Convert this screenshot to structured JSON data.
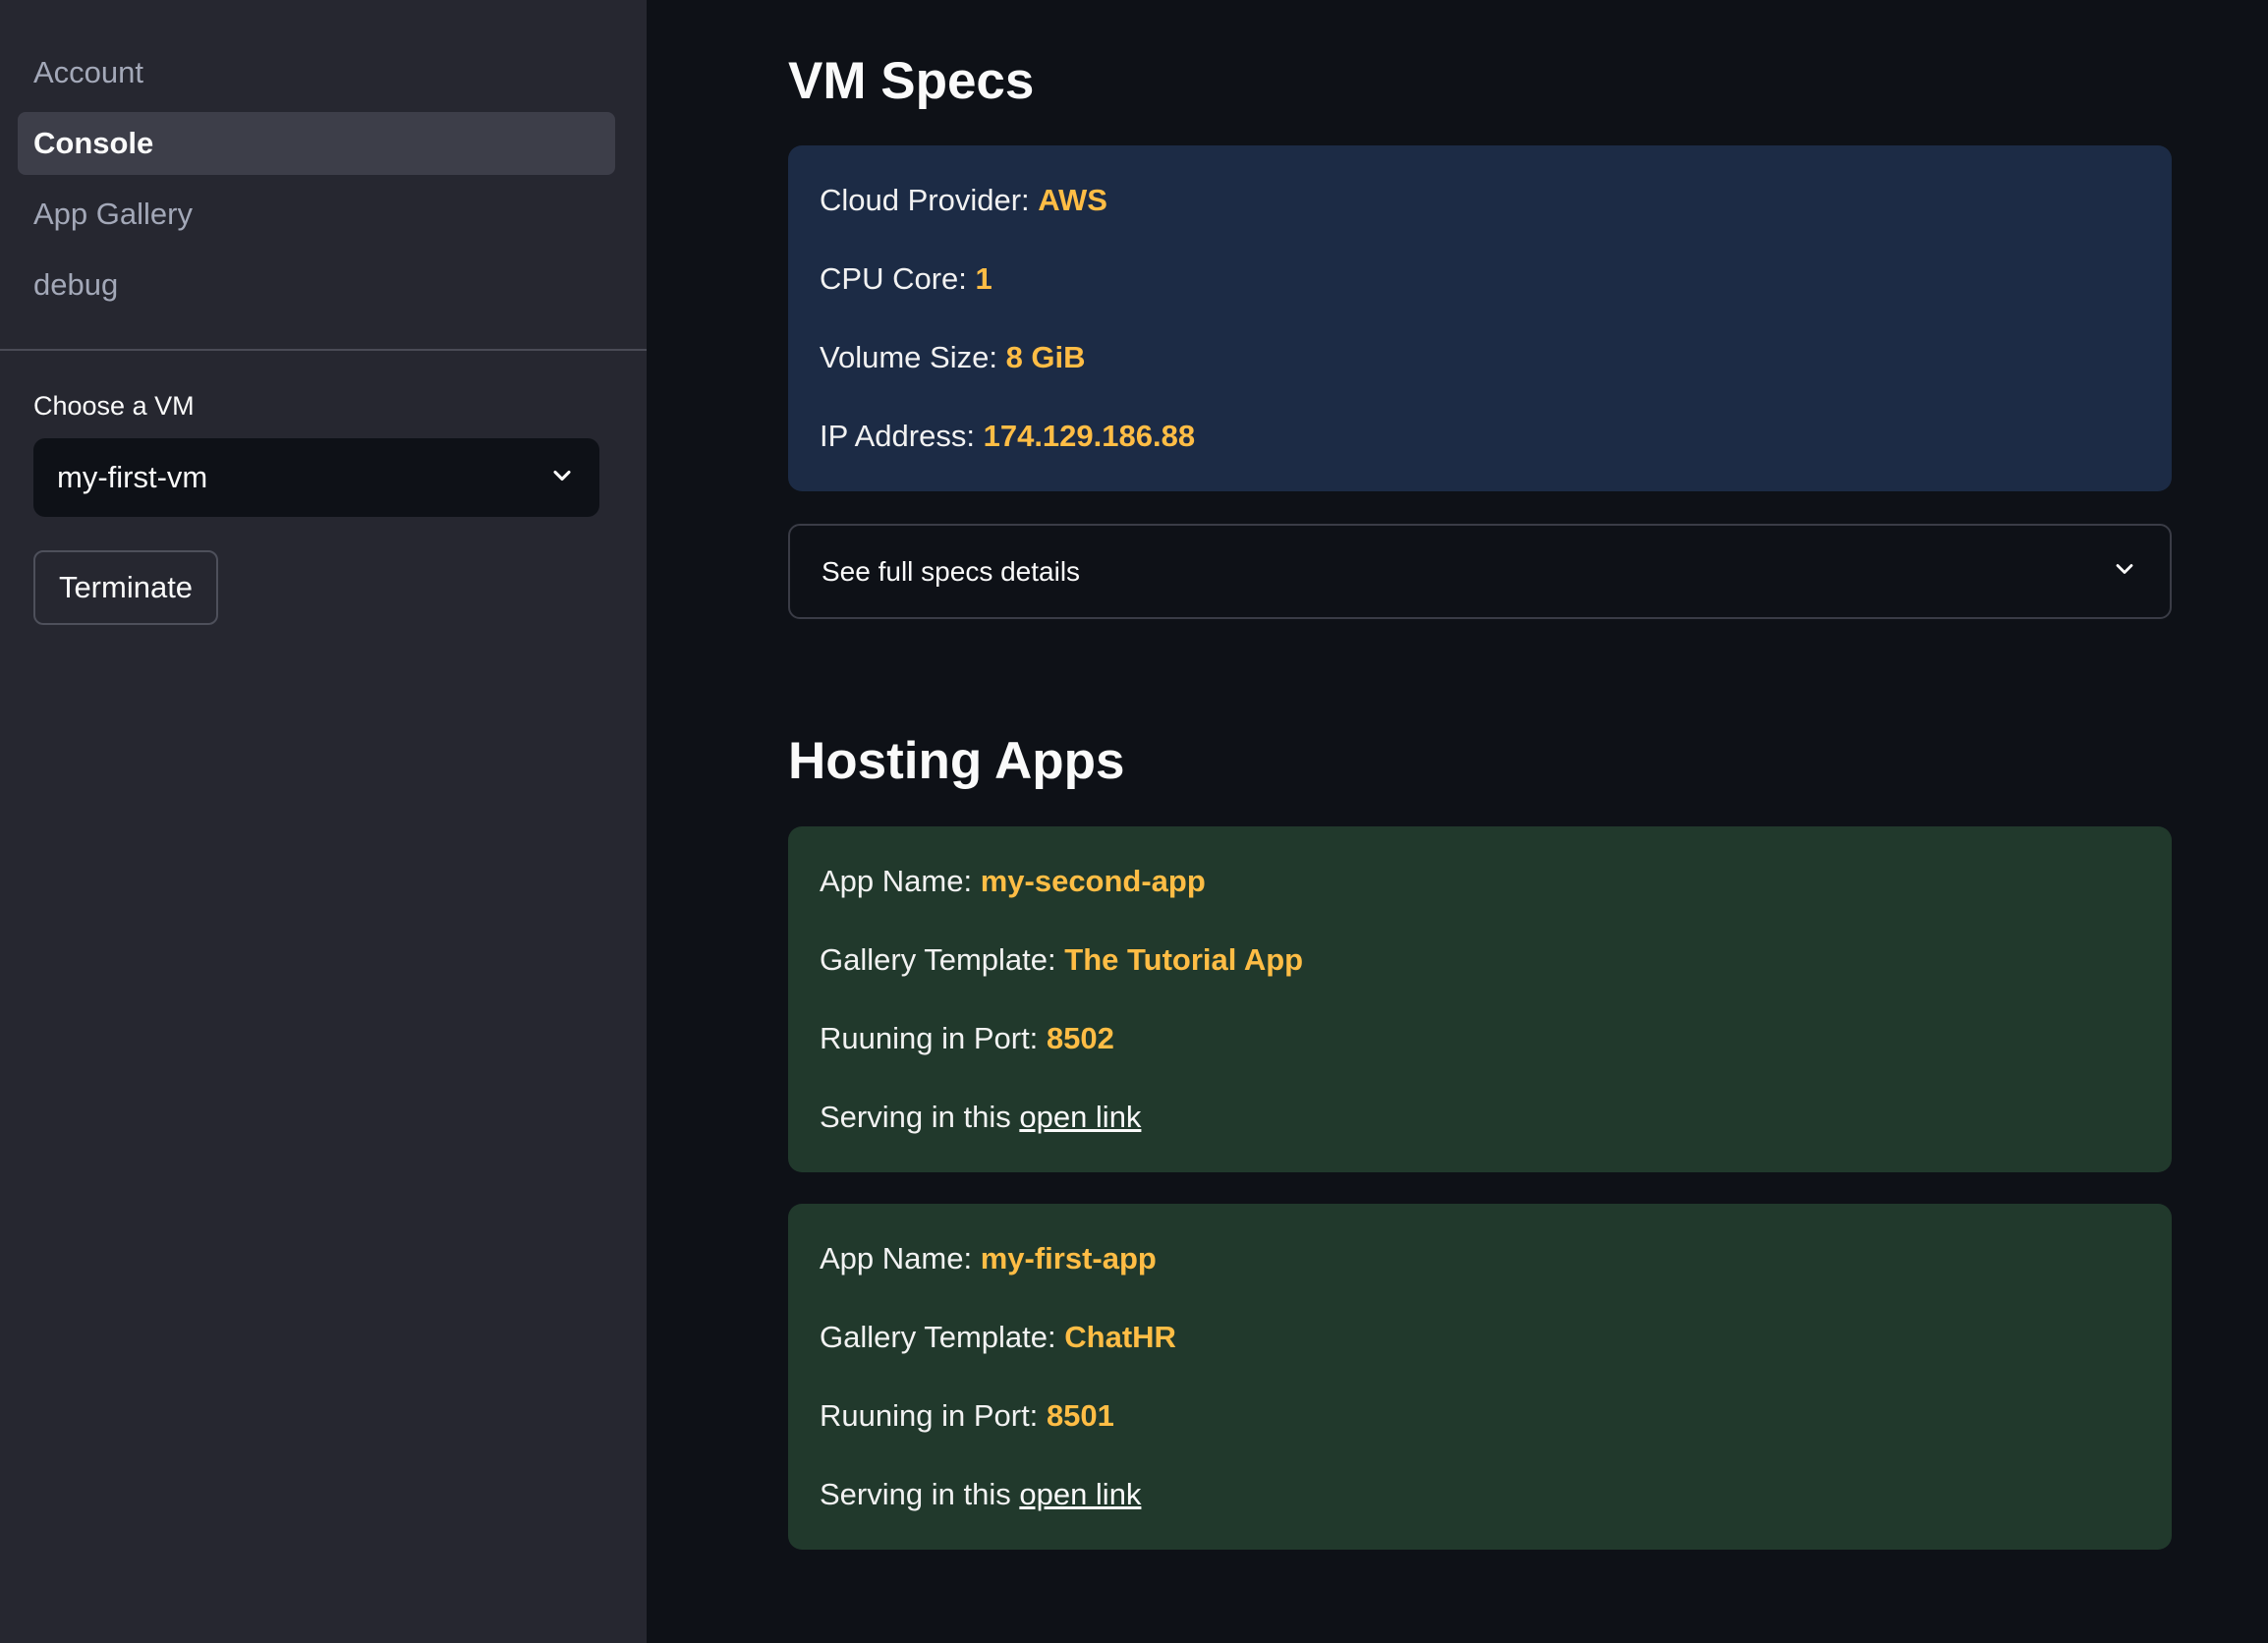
{
  "sidebar": {
    "nav": [
      {
        "label": "Account",
        "active": false
      },
      {
        "label": "Console",
        "active": true
      },
      {
        "label": "App Gallery",
        "active": false
      },
      {
        "label": "debug",
        "active": false
      }
    ],
    "vm_select": {
      "label": "Choose a VM",
      "value": "my-first-vm"
    },
    "terminate_label": "Terminate"
  },
  "vm_specs": {
    "title": "VM Specs",
    "fields": [
      {
        "label": "Cloud Provider:",
        "value": "AWS"
      },
      {
        "label": "CPU Core:",
        "value": "1"
      },
      {
        "label": "Volume Size:",
        "value": "8 GiB"
      },
      {
        "label": "IP Address:",
        "value": "174.129.186.88"
      }
    ],
    "expander_label": "See full specs details"
  },
  "hosting_apps": {
    "title": "Hosting Apps",
    "apps": [
      {
        "name_label": "App Name:",
        "name": "my-second-app",
        "template_label": "Gallery Template:",
        "template": "The Tutorial App",
        "port_label": "Ruuning in Port:",
        "port": "8502",
        "serving_label": "Serving in this",
        "link_text": "open link"
      },
      {
        "name_label": "App Name:",
        "name": "my-first-app",
        "template_label": "Gallery Template:",
        "template": "ChatHR",
        "port_label": "Ruuning in Port:",
        "port": "8501",
        "serving_label": "Serving in this",
        "link_text": "open link"
      }
    ]
  },
  "colors": {
    "sidebar_bg": "#262730",
    "main_bg": "#0e1117",
    "info_card_bg": "#1c2b45",
    "success_card_bg": "#21392c",
    "value_accent": "#ffbd45"
  }
}
